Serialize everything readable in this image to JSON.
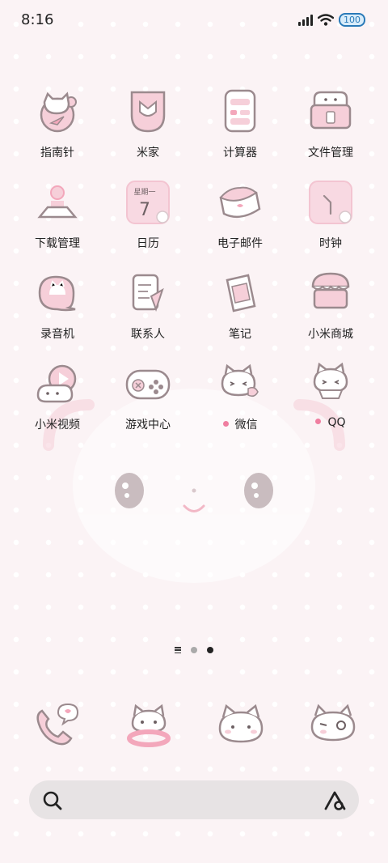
{
  "status_bar": {
    "time": "8:16",
    "battery": "100"
  },
  "apps": [
    {
      "name": "app-compass",
      "label": "指南针",
      "icon": "compass-icon"
    },
    {
      "name": "app-mijia",
      "label": "米家",
      "icon": "mijia-icon"
    },
    {
      "name": "app-calculator",
      "label": "计算器",
      "icon": "calculator-icon"
    },
    {
      "name": "app-file-manager",
      "label": "文件管理",
      "icon": "file-manager-icon"
    },
    {
      "name": "app-downloads",
      "label": "下载管理",
      "icon": "download-icon"
    },
    {
      "name": "app-calendar",
      "label": "日历",
      "icon": "calendar-icon",
      "calendar_weekday": "星期一",
      "calendar_day": "7"
    },
    {
      "name": "app-email",
      "label": "电子邮件",
      "icon": "email-icon"
    },
    {
      "name": "app-clock",
      "label": "时钟",
      "icon": "clock-icon"
    },
    {
      "name": "app-recorder",
      "label": "录音机",
      "icon": "recorder-icon"
    },
    {
      "name": "app-contacts",
      "label": "联系人",
      "icon": "contacts-icon"
    },
    {
      "name": "app-notes",
      "label": "笔记",
      "icon": "notes-icon"
    },
    {
      "name": "app-mi-store",
      "label": "小米商城",
      "icon": "store-icon"
    },
    {
      "name": "app-mi-video",
      "label": "小米视频",
      "icon": "video-icon"
    },
    {
      "name": "app-game-center",
      "label": "游戏中心",
      "icon": "gamepad-icon"
    },
    {
      "name": "app-wechat",
      "label": "微信",
      "icon": "wechat-icon",
      "new_indicator": true
    },
    {
      "name": "app-qq",
      "label": "QQ",
      "icon": "qq-icon",
      "new_indicator": true
    }
  ],
  "page_indicator": {
    "pages": 2,
    "current_page": 2,
    "has_list_page": true
  },
  "dock": [
    {
      "name": "dock-phone",
      "icon": "phone-icon"
    },
    {
      "name": "dock-messages",
      "icon": "messages-icon"
    },
    {
      "name": "dock-browser",
      "icon": "browser-icon"
    },
    {
      "name": "dock-camera",
      "icon": "camera-icon"
    }
  ],
  "search_bar": {
    "search_icon": "search-icon",
    "assistant_icon": "assistant-icon"
  },
  "colors": {
    "icon_pink": "#f6cfd9",
    "icon_outline": "#9b8a8e",
    "background": "#fbf3f5",
    "notification_dot": "#f07ea0"
  }
}
